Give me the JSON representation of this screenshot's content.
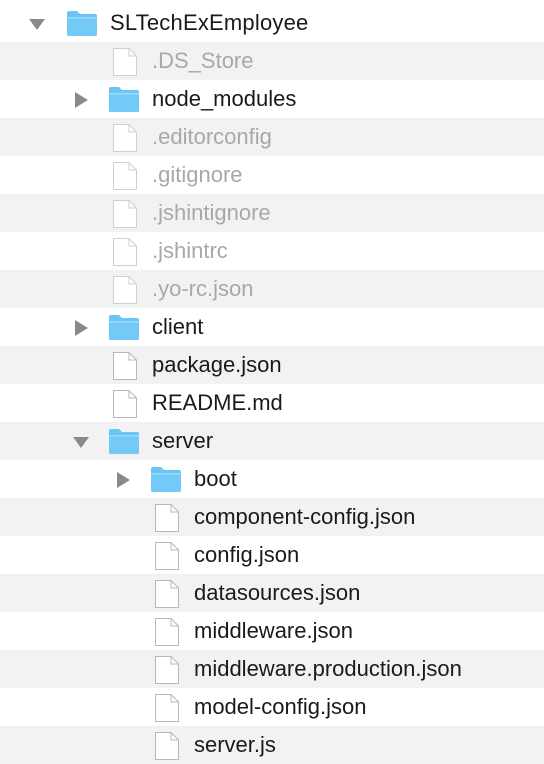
{
  "tree": {
    "root": {
      "name": "SLTechExEmployee",
      "type": "folder",
      "expanded": true
    },
    "items": [
      {
        "name": ".DS_Store",
        "type": "file",
        "hidden": true
      },
      {
        "name": "node_modules",
        "type": "folder",
        "expanded": false
      },
      {
        "name": ".editorconfig",
        "type": "file",
        "hidden": true
      },
      {
        "name": ".gitignore",
        "type": "file",
        "hidden": true
      },
      {
        "name": ".jshintignore",
        "type": "file",
        "hidden": true
      },
      {
        "name": ".jshintrc",
        "type": "file",
        "hidden": true
      },
      {
        "name": ".yo-rc.json",
        "type": "file",
        "hidden": true
      },
      {
        "name": "client",
        "type": "folder",
        "expanded": false
      },
      {
        "name": "package.json",
        "type": "file"
      },
      {
        "name": "README.md",
        "type": "file"
      },
      {
        "name": "server",
        "type": "folder",
        "expanded": true
      },
      {
        "name": "boot",
        "type": "folder",
        "expanded": false
      },
      {
        "name": "component-config.json",
        "type": "file"
      },
      {
        "name": "config.json",
        "type": "file"
      },
      {
        "name": "datasources.json",
        "type": "file"
      },
      {
        "name": "middleware.json",
        "type": "file"
      },
      {
        "name": "middleware.production.json",
        "type": "file"
      },
      {
        "name": "model-config.json",
        "type": "file"
      },
      {
        "name": "server.js",
        "type": "file"
      }
    ]
  },
  "colors": {
    "folder": "#6cc4f4",
    "folder_tab": "#8fd3f8",
    "stripe": "#f2f2f2",
    "hidden_text": "#a8a8a8",
    "text": "#1a1a1a",
    "disclosure": "#8a8a8a"
  },
  "icons": {
    "folder": "folder-icon",
    "file": "file-icon",
    "collapsed": "disclosure-right-icon",
    "expanded": "disclosure-down-icon"
  }
}
